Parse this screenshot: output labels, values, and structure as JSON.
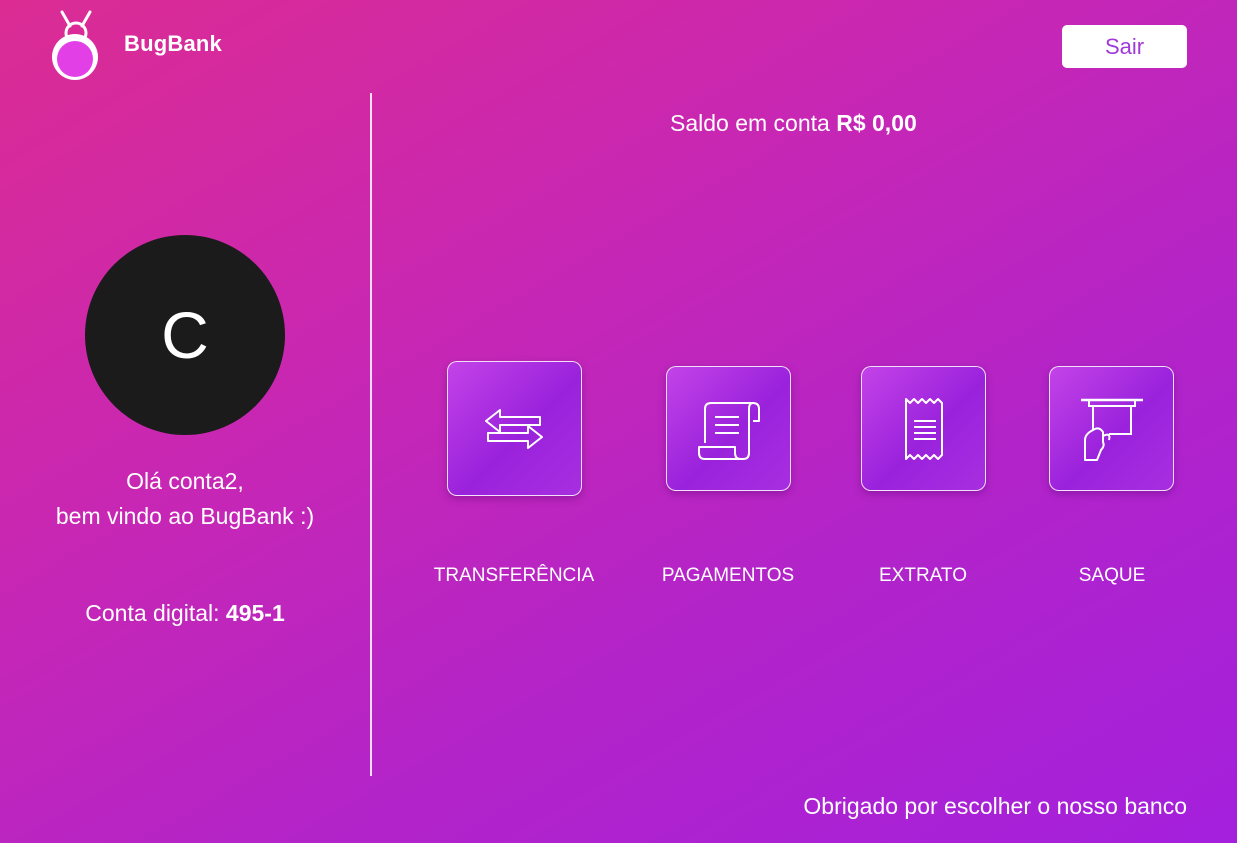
{
  "header": {
    "logo_icon": "bug-icon",
    "brand_name": "BugBank",
    "logout_label": "Sair"
  },
  "balance": {
    "label": "Saldo em conta",
    "value": "R$ 0,00"
  },
  "user": {
    "avatar_initial": "C",
    "greeting_line1": "Olá conta2,",
    "greeting_line2": "bem vindo ao BugBank :)",
    "account_label": "Conta digital:",
    "account_number": "495-1"
  },
  "actions": [
    {
      "label": "TRANSFERÊNCIA",
      "icon": "transfer-arrows-icon"
    },
    {
      "label": "PAGAMENTOS",
      "icon": "scroll-bill-icon"
    },
    {
      "label": "EXTRATO",
      "icon": "receipt-icon"
    },
    {
      "label": "SAQUE",
      "icon": "atm-withdraw-icon"
    }
  ],
  "footer": {
    "text": "Obrigado por escolher o nosso banco"
  },
  "colors": {
    "gradient_start": "#dc2c93",
    "gradient_end": "#a420dd",
    "avatar_bg": "#1b1b1b",
    "button_text": "#a03ad8"
  }
}
